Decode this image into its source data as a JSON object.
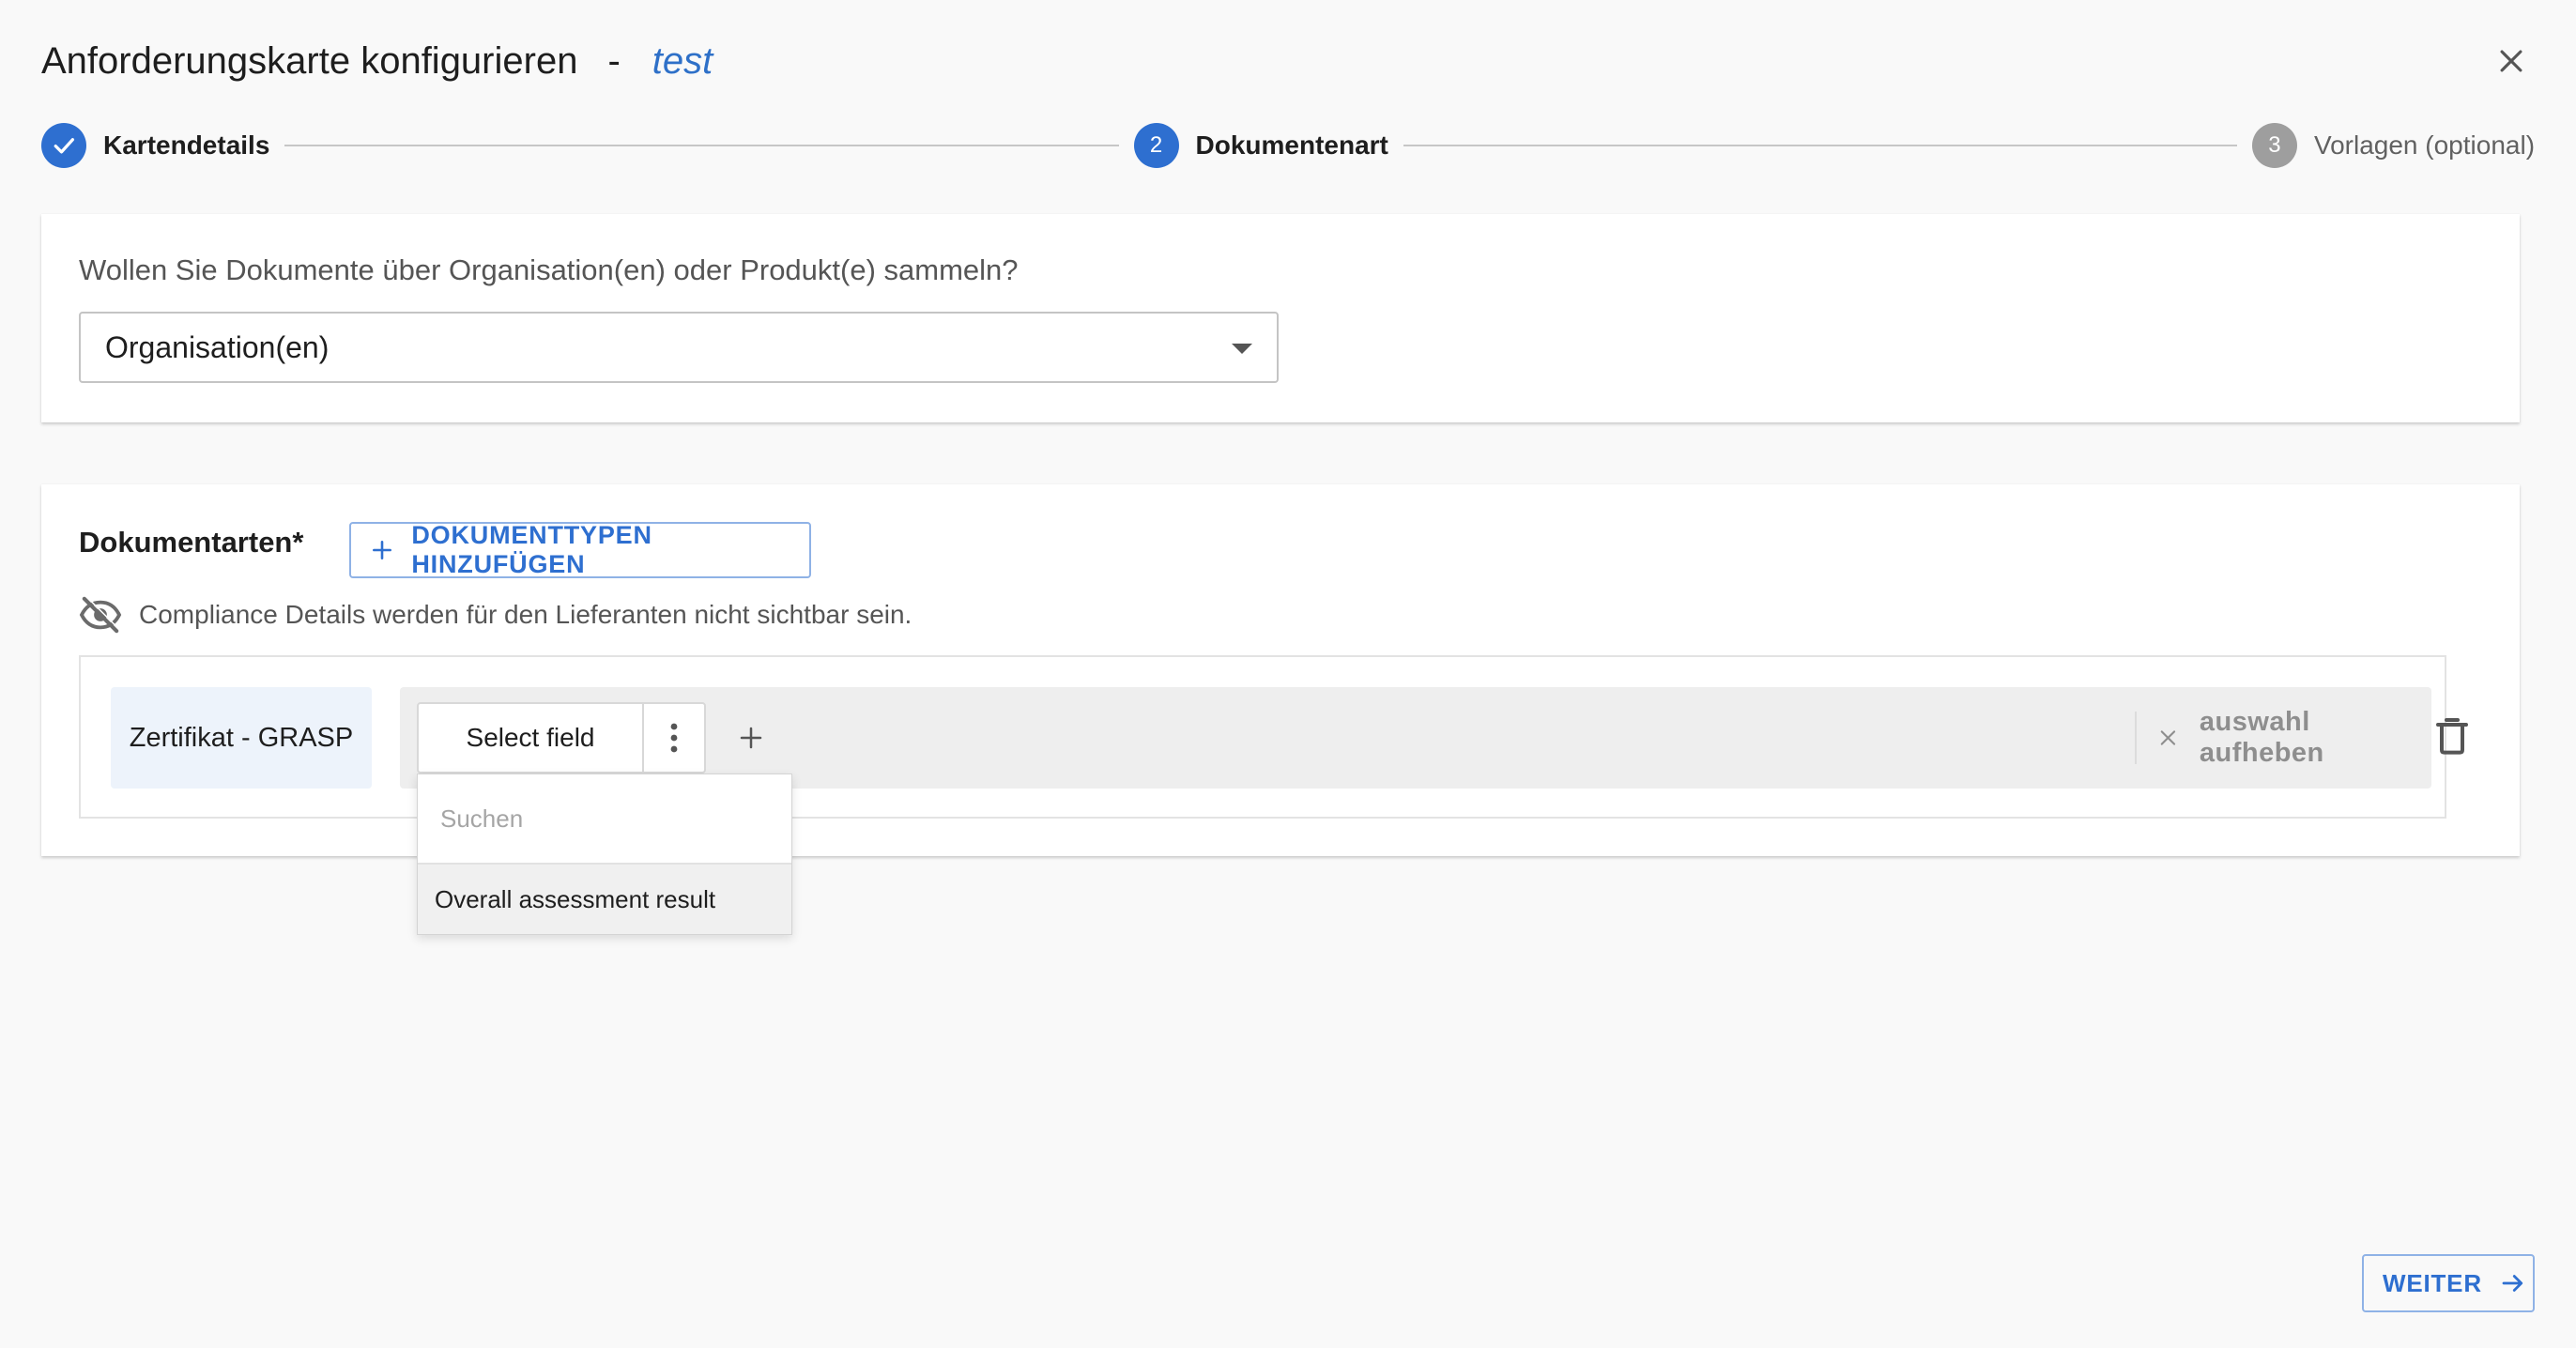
{
  "header": {
    "title": "Anforderungskarte konfigurieren",
    "separator": "-",
    "card_name": "test"
  },
  "stepper": {
    "steps": [
      {
        "number": "1",
        "label": "Kartendetails",
        "state": "done"
      },
      {
        "number": "2",
        "label": "Dokumentenart",
        "state": "active"
      },
      {
        "number": "3",
        "label": "Vorlagen (optional)",
        "state": "pending"
      }
    ]
  },
  "collection": {
    "question": "Wollen Sie Dokumente über Organisation(en) oder Produkt(e) sammeln?",
    "selected_value": "Organisation(en)"
  },
  "document_types": {
    "title": "Dokumentarten*",
    "add_button_label": "DOKUMENTTYPEN HINZUFÜGEN",
    "visibility_notice": "Compliance Details werden für den Lieferanten nicht sichtbar sein.",
    "row": {
      "document_name": "Zertifikat - GRASP",
      "field_chip_label": "Select field",
      "clear_label": "auswahl aufheben"
    }
  },
  "field_dropdown": {
    "search_placeholder": "Suchen",
    "options": [
      "Overall assessment result"
    ]
  },
  "footer": {
    "next_label": "WEITER"
  },
  "colors": {
    "accent": "#2e6fd0",
    "pending": "#9e9e9e",
    "background": "#f9f9f9"
  },
  "icons": [
    "close-icon",
    "check-icon",
    "chevron-down-icon",
    "plus-icon",
    "eye-off-icon",
    "more-vertical-icon",
    "clear-icon",
    "delete-icon",
    "arrow-right-icon"
  ]
}
